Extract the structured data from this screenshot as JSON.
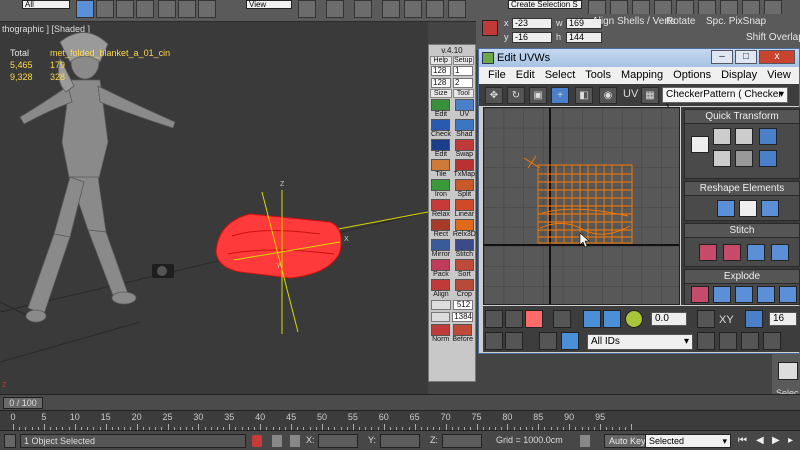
{
  "top_toolbar": {
    "filter_dropdown": "All",
    "view_dropdown": "View",
    "selection_set": "Create Selection S"
  },
  "viewport": {
    "label": "thographic ] [Shaded ]",
    "stats": {
      "header": [
        "Total",
        "met_folded_blanket_a_01_cin"
      ],
      "rows": [
        [
          "5,465",
          "179"
        ],
        [
          "9,328",
          "328"
        ]
      ]
    }
  },
  "unwrap_panel": {
    "version": "v.4.10",
    "header_buttons": [
      "Help",
      "Setup"
    ],
    "spinners": [
      "128",
      "1"
    ],
    "spinners2": [
      "128",
      "2"
    ],
    "size_labels": [
      "Size",
      "Tool"
    ],
    "tools": [
      "Edit",
      "UV",
      "Check",
      "Shad",
      "Edit",
      "Swap",
      "Tile",
      "TxMap",
      "Iron",
      "Split",
      "Relax",
      "Linear",
      "Rect",
      "Relx3D",
      "Mirror",
      "Stitch",
      "Pack",
      "Sort",
      "Align",
      "Crop"
    ],
    "pix_value": "512",
    "per_value": "1384",
    "bottom_labels": [
      "Norm",
      "Before"
    ]
  },
  "right_top": {
    "spin_x_label": "x",
    "spin_x": "-23",
    "spin_y_label": "y",
    "spin_y": "-16",
    "spin_w_label": "w",
    "spin_w": "169",
    "spin_h_label": "h",
    "spin_h": "144",
    "labels": [
      "Align Shells / Verts",
      "Rotate",
      "Spc. PixSnap"
    ],
    "shift_overlap": "Shift Overlap"
  },
  "uvw_dialog": {
    "title": "Edit UVWs",
    "window_buttons": [
      "–",
      "□",
      "x"
    ],
    "menu": [
      "File",
      "Edit",
      "Select",
      "Tools",
      "Mapping",
      "Options",
      "Display",
      "View"
    ],
    "uv_label": "UV",
    "texture_dropdown": "CheckerPattern  ( Checker )",
    "rollouts": [
      "Quick Transform",
      "Reshape Elements",
      "Stitch",
      "Explode"
    ],
    "bottom": {
      "value1": "0.0",
      "xy_label": "XY",
      "value2": "16",
      "ids_dropdown": "All IDs"
    }
  },
  "timeline": {
    "slider_label": "0 / 100",
    "ticks": [
      "0",
      "5",
      "10",
      "15",
      "20",
      "25",
      "30",
      "35",
      "40",
      "45",
      "50",
      "55",
      "60",
      "65",
      "70",
      "75",
      "80",
      "85",
      "90",
      "95"
    ]
  },
  "status_bar": {
    "selection": "1 Object Selected",
    "x_label": "X:",
    "y_label": "Y:",
    "z_label": "Z:",
    "grid": "Grid = 1000.0cm",
    "auto_key": "Auto Key",
    "selected_dropdown": "Selected",
    "right_label": "Selec"
  },
  "colors": {
    "accent": "#5b8fd8",
    "selection_red": "#ff3a3a",
    "uv_orange": "#ff7a00",
    "title_blue": "#a7c2e3"
  }
}
